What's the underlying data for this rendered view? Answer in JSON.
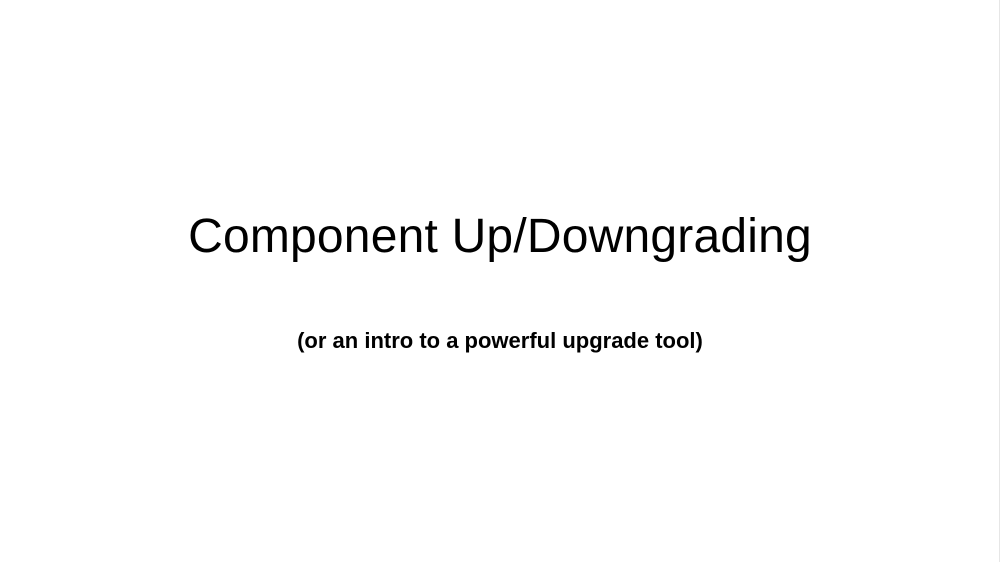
{
  "slide": {
    "title": "Component Up/Downgrading",
    "subtitle": "(or an intro to a powerful upgrade tool)",
    "background_color": "#ffffff",
    "text_color": "#000000"
  }
}
